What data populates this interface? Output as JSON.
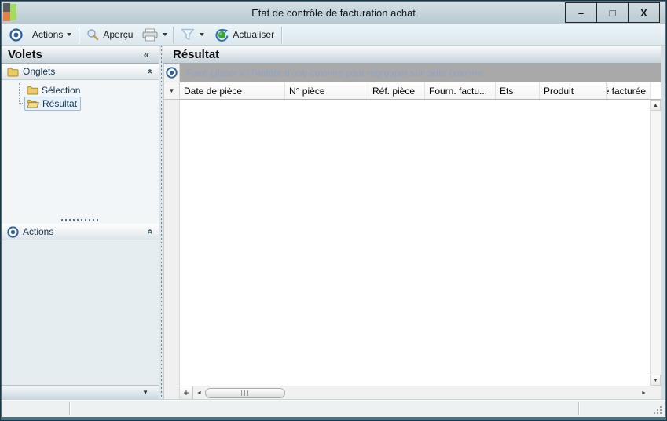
{
  "window": {
    "title": "Etat de contrôle de facturation achat",
    "controls": {
      "minimize": "–",
      "maximize": "□",
      "close": "X"
    }
  },
  "toolbar": {
    "actions_label": "Actions",
    "preview_label": "Aperçu",
    "refresh_label": "Actualiser"
  },
  "sidebar": {
    "title": "Volets",
    "onglets_group": {
      "label": "Onglets",
      "items": [
        {
          "label": "Sélection",
          "selected": false
        },
        {
          "label": "Résultat",
          "selected": true
        }
      ]
    },
    "actions_group": {
      "label": "Actions"
    }
  },
  "main": {
    "title": "Résultat",
    "group_hint": "Faire glisser ici l'entête d'une colonne pour regrouper sur cette colonne",
    "columns": [
      "Date de pièce",
      "N° pièce",
      "Réf. pièce",
      "Fourn. factu...",
      "Ets",
      "Produit",
      "Qté facturée"
    ],
    "rows": []
  },
  "grid": {
    "customize_glyph": "+"
  },
  "icons": {
    "collapse_left": "«",
    "chevron_double_up": "«",
    "scroll_up": "▲",
    "scroll_down": "▼",
    "scroll_left": "◄",
    "scroll_right": "►",
    "row_indicator": "▼",
    "panel_drop_arrow": "▼"
  },
  "colors": {
    "frame": "#4c7082",
    "titlebar": "#c5d3d9",
    "toolbar": "#e3edf2",
    "group_bar_bg": "#a9a9a9",
    "group_hint_text": "#8ea5c5",
    "selection_bg": "#e4f1fb",
    "selection_border": "#9abcd6",
    "accent_blue": "#2c5f9b",
    "folder_gold": "#eccb67"
  }
}
